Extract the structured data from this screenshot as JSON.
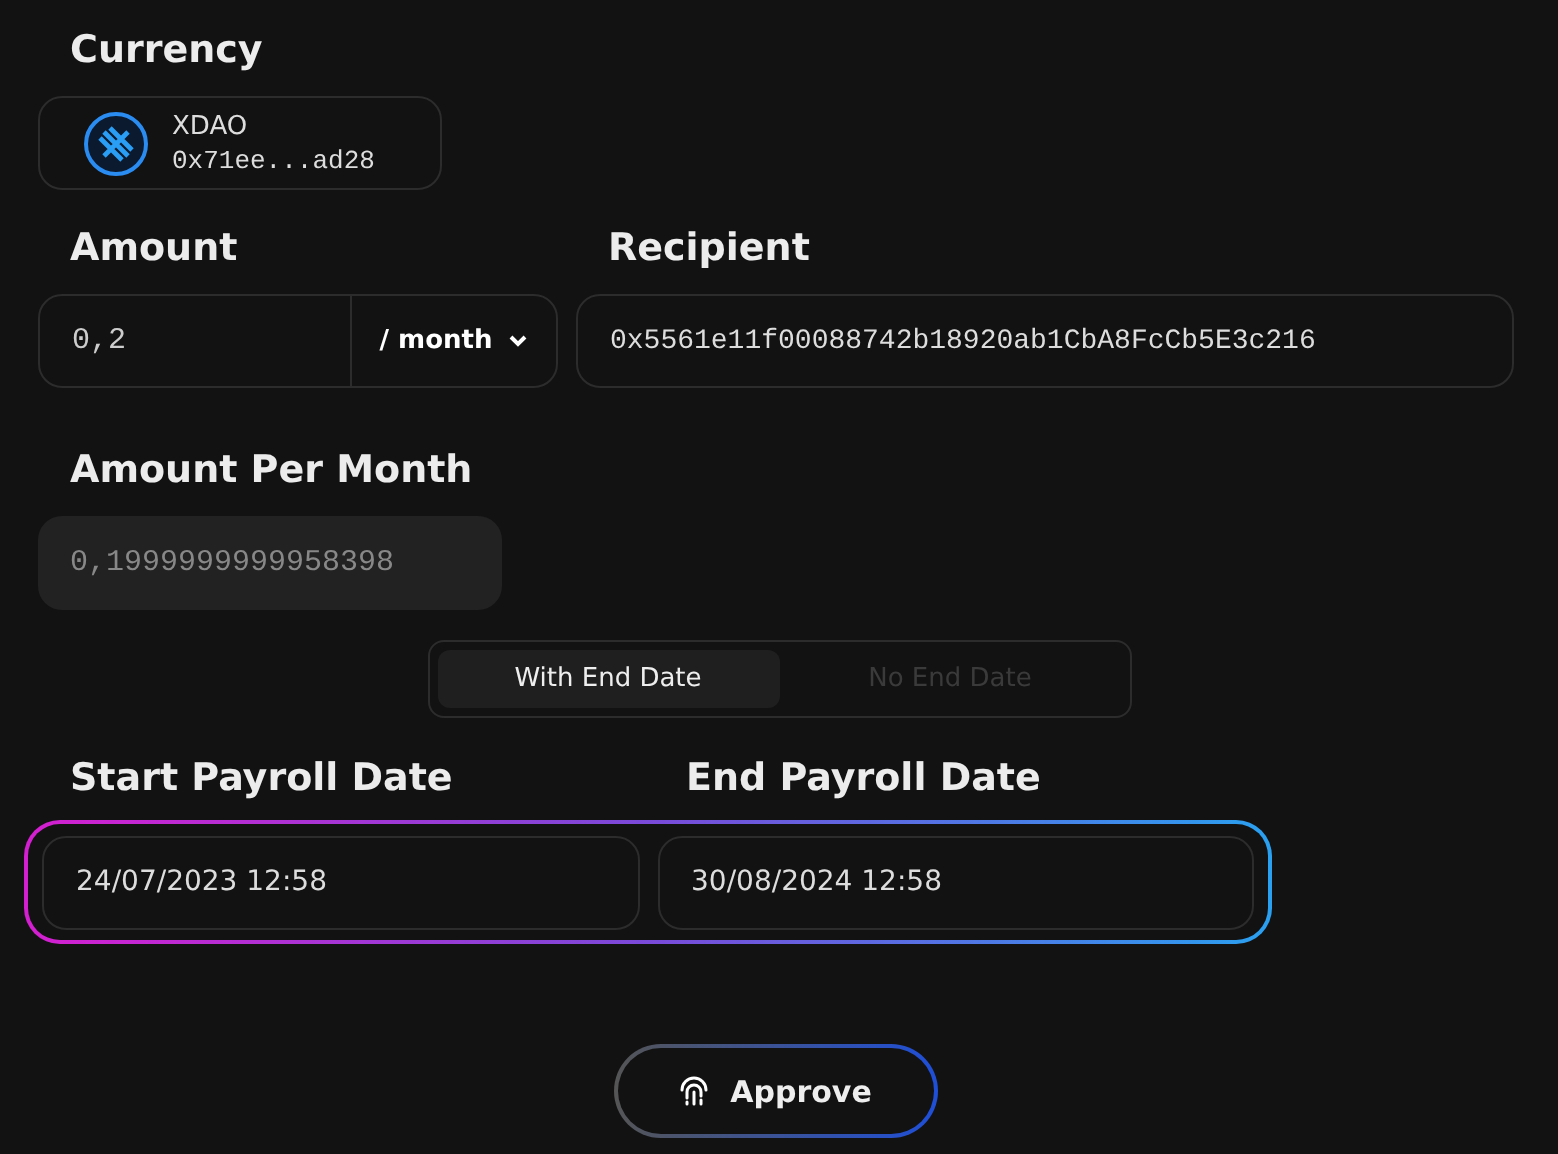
{
  "currency": {
    "label": "Currency",
    "token": {
      "name": "XDAO",
      "address": "0x71ee...ad28"
    }
  },
  "amount": {
    "label": "Amount",
    "value": "0,2",
    "period": "/ month"
  },
  "recipient": {
    "label": "Recipient",
    "value": "0x5561e11f00088742b18920ab1CbA8FcCb5E3c216"
  },
  "amount_per_month": {
    "label": "Amount Per Month",
    "value": "0,1999999999958398",
    "disabled": true
  },
  "end_date_toggle": [
    {
      "label": "With End Date",
      "selected": true
    },
    {
      "label": "No End Date",
      "selected": false
    }
  ],
  "start_date": {
    "label": "Start Payroll Date",
    "value": "24/07/2023 12:58"
  },
  "end_date": {
    "label": "End Payroll Date",
    "value": "30/08/2024 12:58"
  },
  "approve_button": {
    "label": "Approve"
  }
}
